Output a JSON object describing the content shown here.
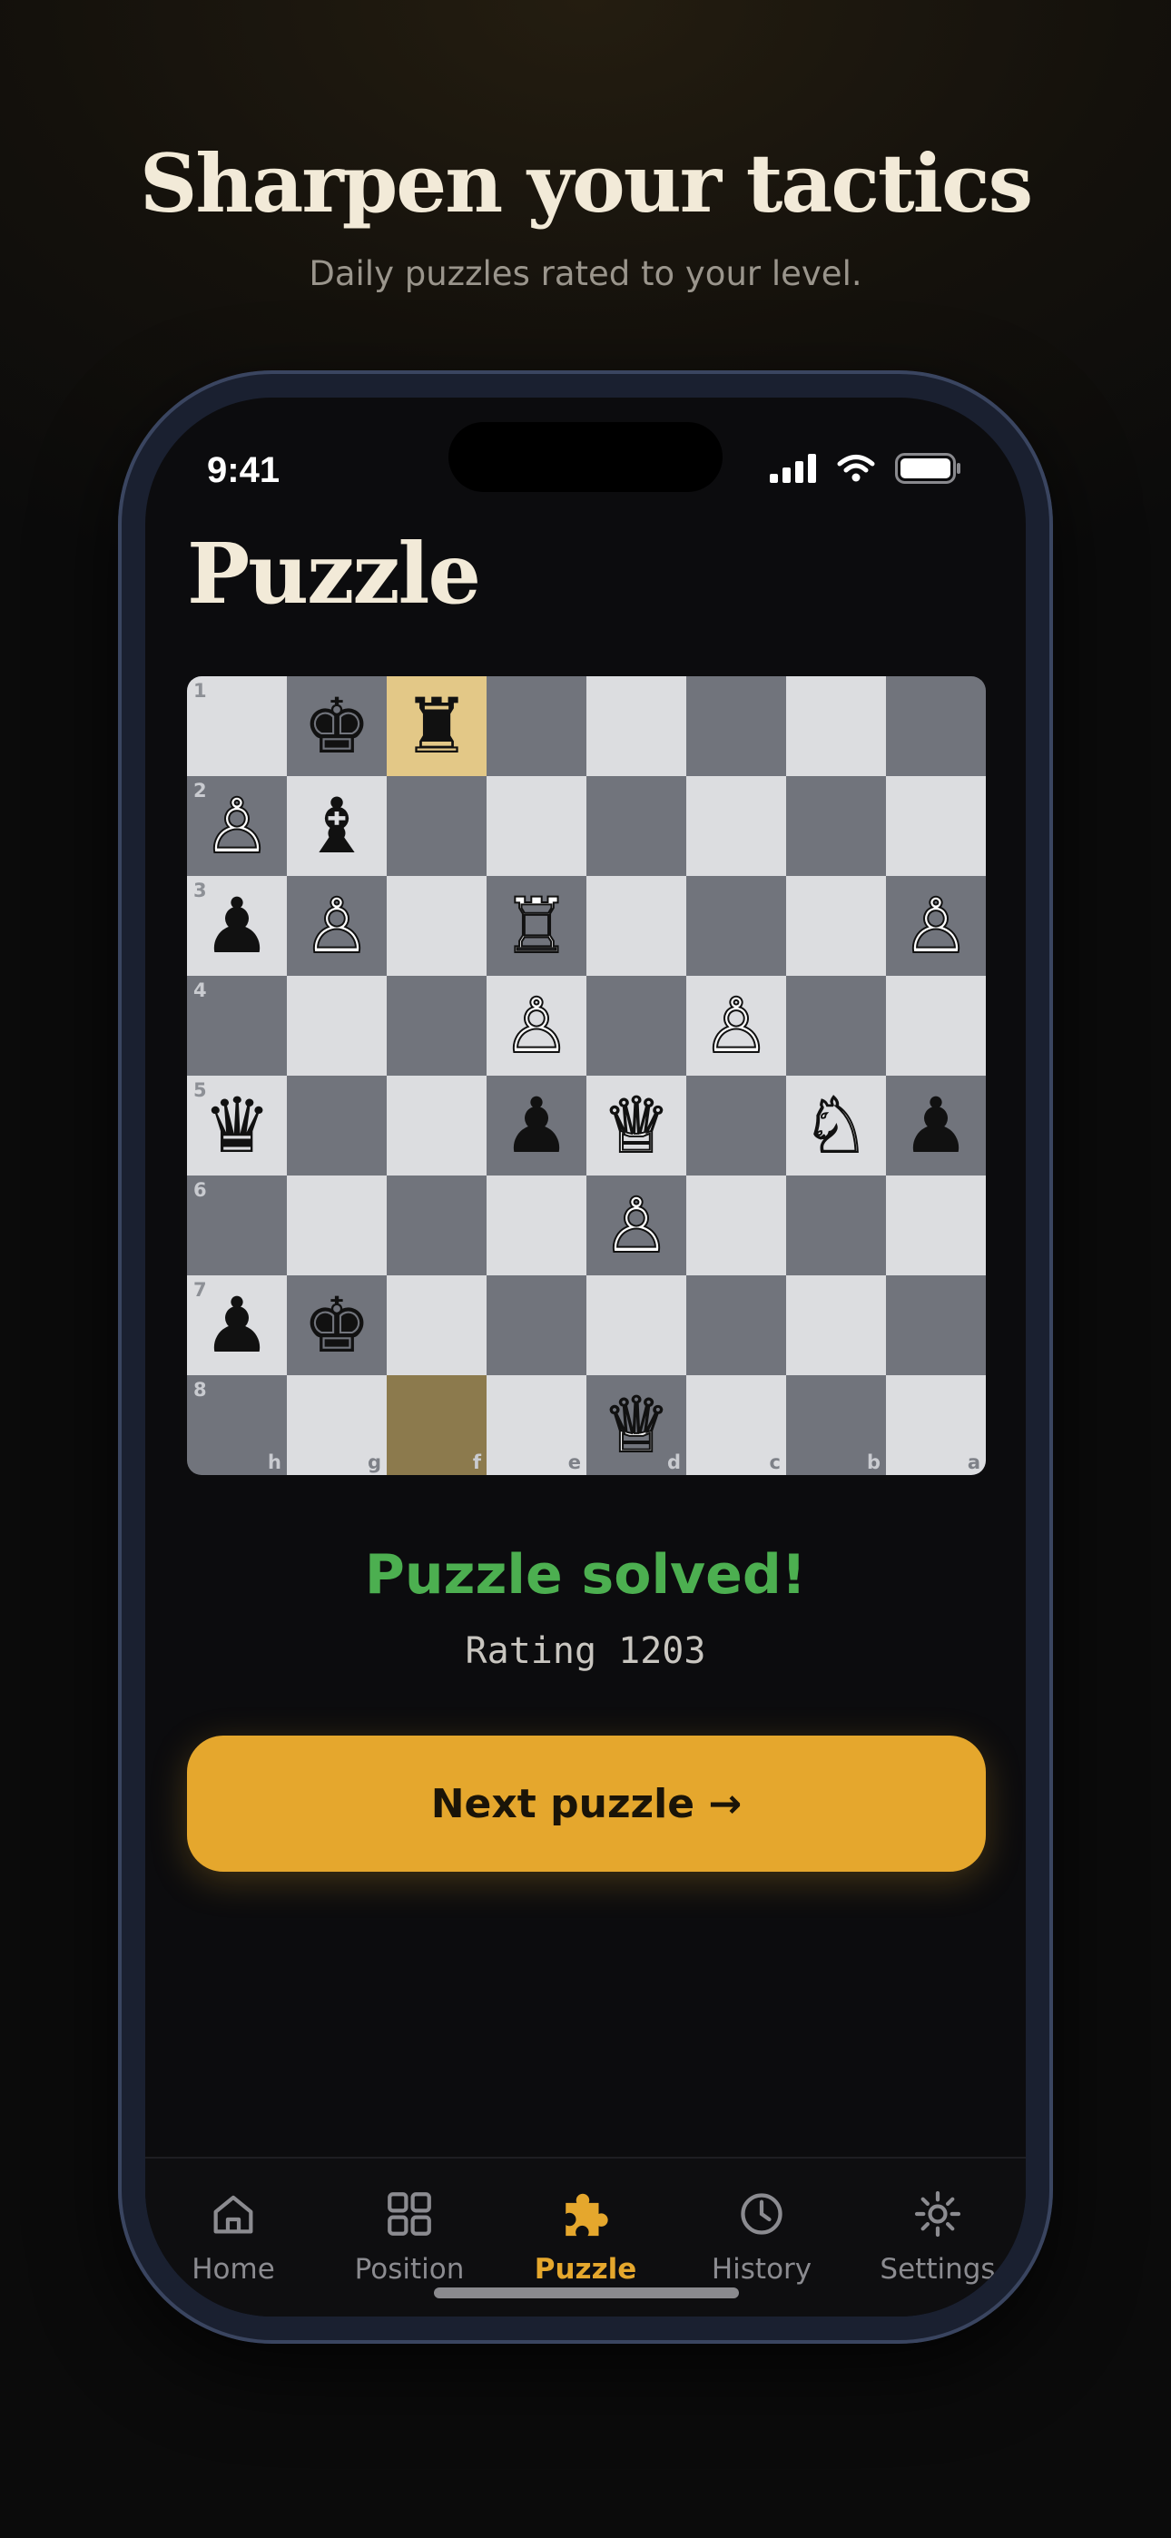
{
  "marketing": {
    "headline": "Sharpen your tactics",
    "subheadline": "Daily puzzles rated to your level."
  },
  "status_bar": {
    "time": "9:41"
  },
  "screen": {
    "title": "Puzzle"
  },
  "board": {
    "ranks": [
      "1",
      "2",
      "3",
      "4",
      "5",
      "6",
      "7",
      "8"
    ],
    "files": [
      "h",
      "g",
      "f",
      "e",
      "d",
      "c",
      "b",
      "a"
    ],
    "highlighted_squares": [
      "f1",
      "f8"
    ],
    "pieces": [
      {
        "square": "g1",
        "color": "black",
        "type": "king"
      },
      {
        "square": "f1",
        "color": "black",
        "type": "rook"
      },
      {
        "square": "h2",
        "color": "white",
        "type": "pawn"
      },
      {
        "square": "g2",
        "color": "black",
        "type": "bishop"
      },
      {
        "square": "h3",
        "color": "black",
        "type": "pawn"
      },
      {
        "square": "g3",
        "color": "white",
        "type": "pawn"
      },
      {
        "square": "e3",
        "color": "white",
        "type": "rook"
      },
      {
        "square": "a3",
        "color": "white",
        "type": "pawn"
      },
      {
        "square": "e4",
        "color": "white",
        "type": "pawn"
      },
      {
        "square": "c4",
        "color": "white",
        "type": "pawn"
      },
      {
        "square": "h5",
        "color": "black",
        "type": "queen"
      },
      {
        "square": "e5",
        "color": "black",
        "type": "pawn"
      },
      {
        "square": "d5",
        "color": "white",
        "type": "queen"
      },
      {
        "square": "b5",
        "color": "white",
        "type": "knight"
      },
      {
        "square": "a5",
        "color": "black",
        "type": "pawn"
      },
      {
        "square": "d6",
        "color": "white",
        "type": "pawn"
      },
      {
        "square": "h7",
        "color": "black",
        "type": "pawn"
      },
      {
        "square": "g7",
        "color": "black",
        "type": "king"
      },
      {
        "square": "d8",
        "color": "white",
        "type": "queen"
      }
    ]
  },
  "result": {
    "status": "Puzzle solved!",
    "rating": "Rating 1203"
  },
  "next_button": {
    "label": "Next puzzle →"
  },
  "tabs": [
    {
      "label": "Home",
      "icon": "home-icon",
      "active": false
    },
    {
      "label": "Position",
      "icon": "grid-icon",
      "active": false
    },
    {
      "label": "Puzzle",
      "icon": "puzzle-icon",
      "active": true
    },
    {
      "label": "History",
      "icon": "clock-icon",
      "active": false
    },
    {
      "label": "Settings",
      "icon": "gear-icon",
      "active": false
    }
  ],
  "colors": {
    "accent": "#e5a72d",
    "success": "#4caf50",
    "light_square": "#dcdde0",
    "dark_square": "#71747c",
    "highlight_from": "#e3c887",
    "highlight_to": "#8c7a4d"
  }
}
